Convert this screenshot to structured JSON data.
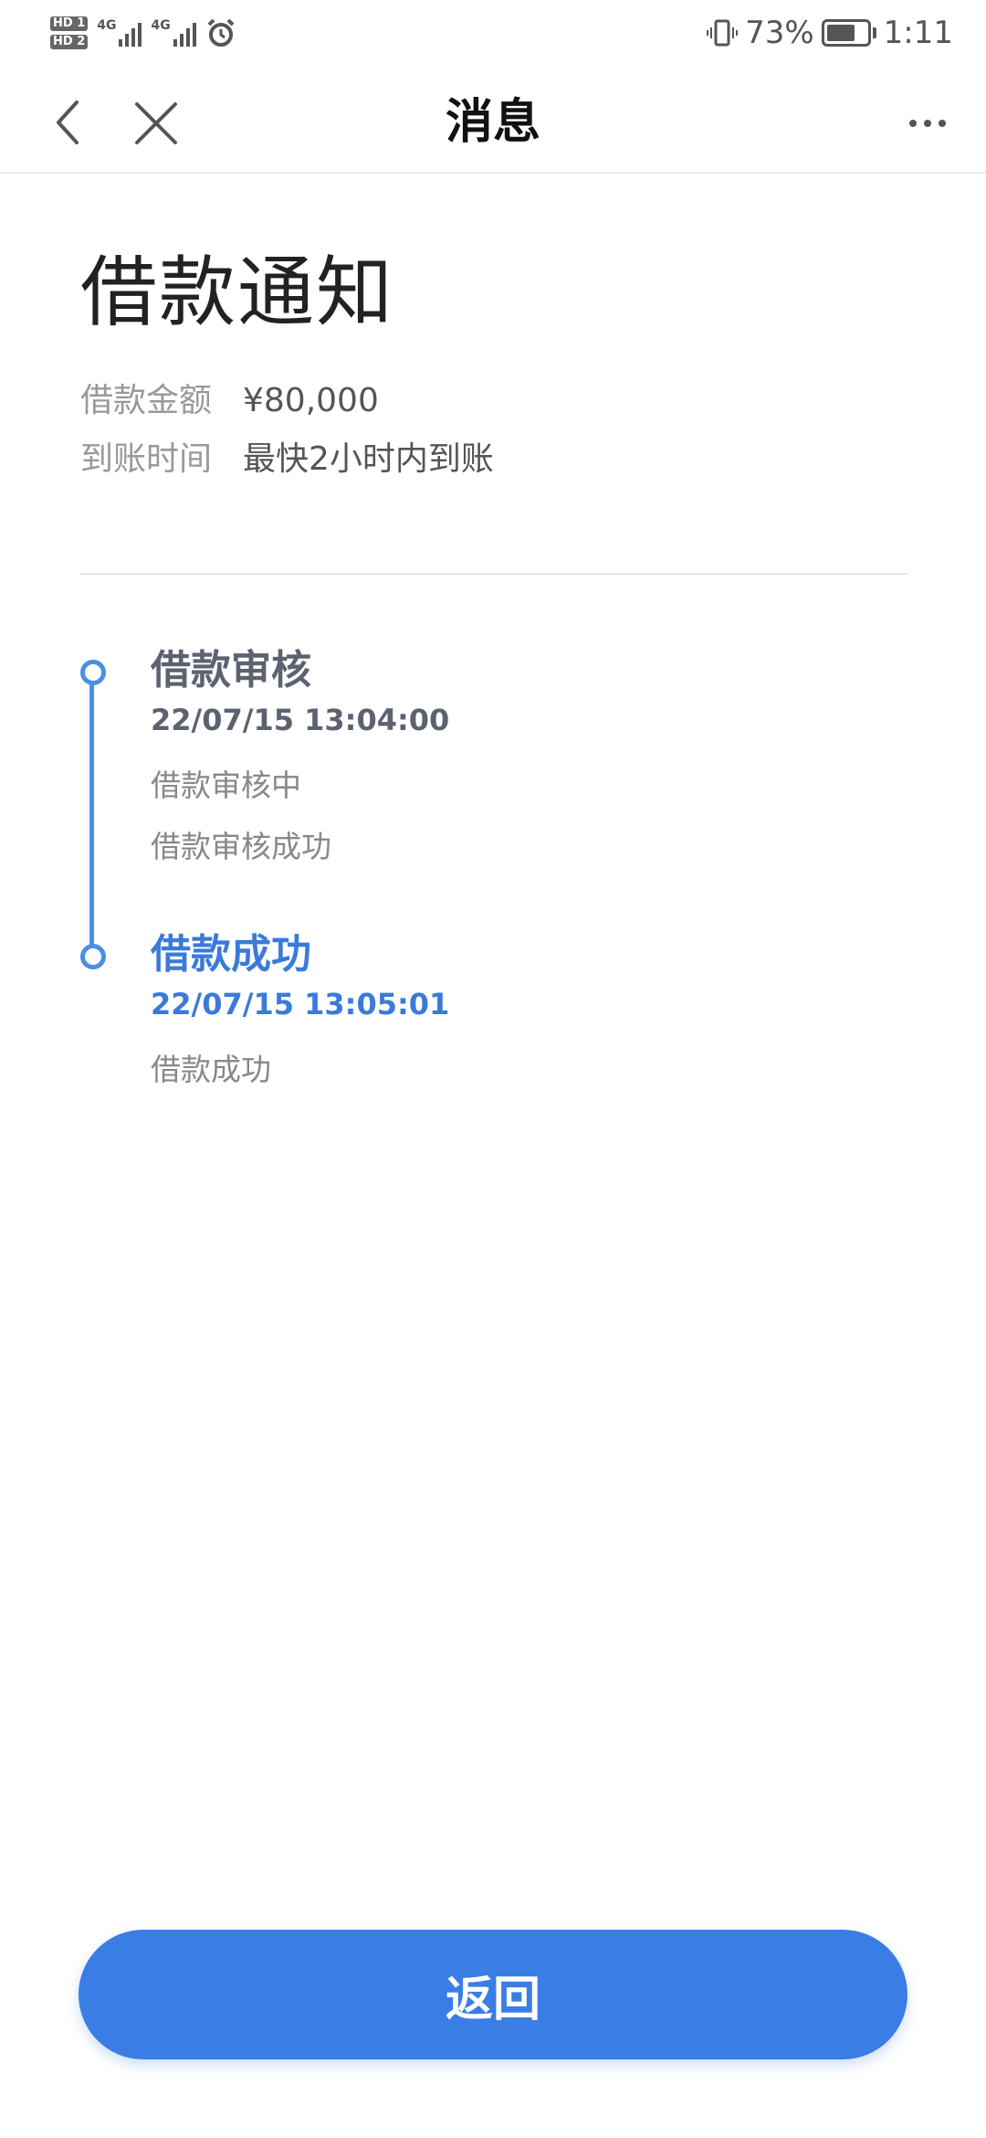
{
  "status_bar": {
    "hd1": "HD 1",
    "hd2": "HD 2",
    "net1": "4G",
    "net2": "4G",
    "battery_percent": "73%",
    "battery_level": 0.73,
    "time": "1:11"
  },
  "nav": {
    "title": "消息",
    "back_icon": "chevron-left",
    "close_icon": "close",
    "more_icon": "more-horizontal"
  },
  "notice": {
    "title": "借款通知",
    "amount_label": "借款金额",
    "amount_value": "¥80,000",
    "arrival_label": "到账时间",
    "arrival_value": "最快2小时内到账"
  },
  "timeline": [
    {
      "title": "借款审核",
      "time": "22/07/15 13:04:00",
      "descriptions": [
        "借款审核中",
        "借款审核成功"
      ]
    },
    {
      "title": "借款成功",
      "time": "22/07/15 13:05:01",
      "descriptions": [
        "借款成功"
      ]
    }
  ],
  "colors": {
    "accent": "#3a7de4",
    "timeline": "#4a90e2",
    "step_gray": "#5d6270"
  },
  "back_button_label": "返回"
}
